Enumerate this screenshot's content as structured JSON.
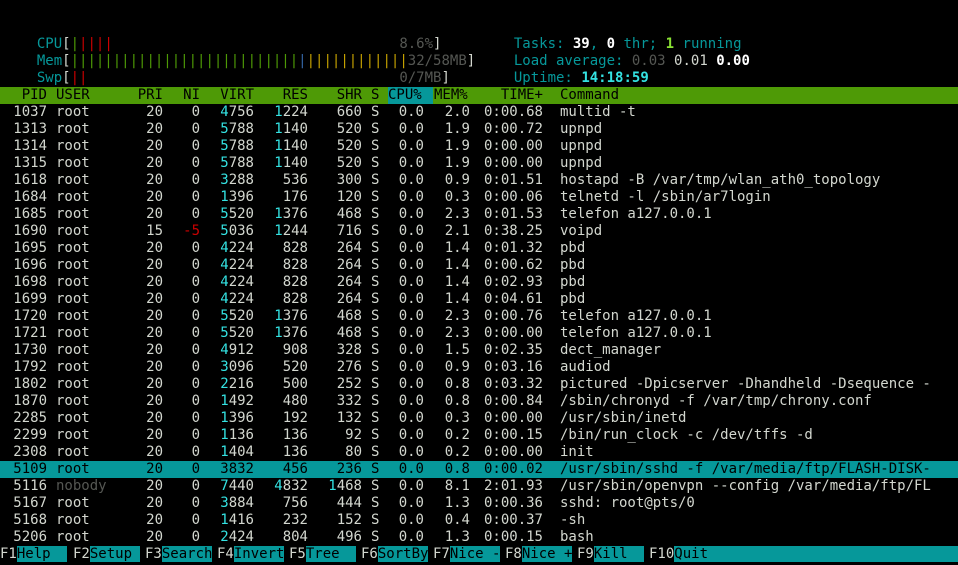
{
  "meters": {
    "cpu": {
      "label": "CPU",
      "value": "8.6%"
    },
    "mem": {
      "label": "Mem",
      "value": "32/58MB"
    },
    "swp": {
      "label": "Swp",
      "value": "0/7MB"
    }
  },
  "summary": {
    "tasks_label": "Tasks:",
    "tasks": "39",
    "sep1": ",",
    "thr": "0",
    "thr_label": "thr;",
    "running": "1",
    "running_label": "running",
    "load_label": "Load average:",
    "load1": "0.03",
    "load5": "0.01",
    "load15": "0.00",
    "uptime_label": "Uptime:",
    "uptime": "14:18:59"
  },
  "columns": [
    "PID",
    "USER",
    "PRI",
    "NI",
    "VIRT",
    "RES",
    "SHR",
    "S",
    "CPU%",
    "MEM%",
    "TIME+",
    "Command"
  ],
  "rows": [
    {
      "pid": "1037",
      "user": "root",
      "pri": "20",
      "ni": "0",
      "virt": "4756",
      "res": "1224",
      "shr": "660",
      "s": "S",
      "cpu": "0.0",
      "mem": "2.0",
      "time": "0:00.68",
      "cmd": "multid -t"
    },
    {
      "pid": "1313",
      "user": "root",
      "pri": "20",
      "ni": "0",
      "virt": "5788",
      "res": "1140",
      "shr": "520",
      "s": "S",
      "cpu": "0.0",
      "mem": "1.9",
      "time": "0:00.72",
      "cmd": "upnpd"
    },
    {
      "pid": "1314",
      "user": "root",
      "pri": "20",
      "ni": "0",
      "virt": "5788",
      "res": "1140",
      "shr": "520",
      "s": "S",
      "cpu": "0.0",
      "mem": "1.9",
      "time": "0:00.00",
      "cmd": "upnpd"
    },
    {
      "pid": "1315",
      "user": "root",
      "pri": "20",
      "ni": "0",
      "virt": "5788",
      "res": "1140",
      "shr": "520",
      "s": "S",
      "cpu": "0.0",
      "mem": "1.9",
      "time": "0:00.00",
      "cmd": "upnpd"
    },
    {
      "pid": "1618",
      "user": "root",
      "pri": "20",
      "ni": "0",
      "virt": "3288",
      "res": "536",
      "shr": "300",
      "s": "S",
      "cpu": "0.0",
      "mem": "0.9",
      "time": "0:01.51",
      "cmd": "hostapd -B /var/tmp/wlan_ath0_topology"
    },
    {
      "pid": "1684",
      "user": "root",
      "pri": "20",
      "ni": "0",
      "virt": "1396",
      "res": "176",
      "shr": "120",
      "s": "S",
      "cpu": "0.0",
      "mem": "0.3",
      "time": "0:00.06",
      "cmd": "telnetd -l /sbin/ar7login"
    },
    {
      "pid": "1685",
      "user": "root",
      "pri": "20",
      "ni": "0",
      "virt": "5520",
      "res": "1376",
      "shr": "468",
      "s": "S",
      "cpu": "0.0",
      "mem": "2.3",
      "time": "0:01.53",
      "cmd": "telefon a127.0.0.1"
    },
    {
      "pid": "1690",
      "user": "root",
      "pri": "15",
      "ni": "-5",
      "virt": "5036",
      "res": "1244",
      "shr": "716",
      "s": "S",
      "cpu": "0.0",
      "mem": "2.1",
      "time": "0:38.25",
      "cmd": "voipd"
    },
    {
      "pid": "1695",
      "user": "root",
      "pri": "20",
      "ni": "0",
      "virt": "4224",
      "res": "828",
      "shr": "264",
      "s": "S",
      "cpu": "0.0",
      "mem": "1.4",
      "time": "0:01.32",
      "cmd": "pbd"
    },
    {
      "pid": "1696",
      "user": "root",
      "pri": "20",
      "ni": "0",
      "virt": "4224",
      "res": "828",
      "shr": "264",
      "s": "S",
      "cpu": "0.0",
      "mem": "1.4",
      "time": "0:00.62",
      "cmd": "pbd"
    },
    {
      "pid": "1698",
      "user": "root",
      "pri": "20",
      "ni": "0",
      "virt": "4224",
      "res": "828",
      "shr": "264",
      "s": "S",
      "cpu": "0.0",
      "mem": "1.4",
      "time": "0:02.93",
      "cmd": "pbd"
    },
    {
      "pid": "1699",
      "user": "root",
      "pri": "20",
      "ni": "0",
      "virt": "4224",
      "res": "828",
      "shr": "264",
      "s": "S",
      "cpu": "0.0",
      "mem": "1.4",
      "time": "0:04.61",
      "cmd": "pbd"
    },
    {
      "pid": "1720",
      "user": "root",
      "pri": "20",
      "ni": "0",
      "virt": "5520",
      "res": "1376",
      "shr": "468",
      "s": "S",
      "cpu": "0.0",
      "mem": "2.3",
      "time": "0:00.76",
      "cmd": "telefon a127.0.0.1"
    },
    {
      "pid": "1721",
      "user": "root",
      "pri": "20",
      "ni": "0",
      "virt": "5520",
      "res": "1376",
      "shr": "468",
      "s": "S",
      "cpu": "0.0",
      "mem": "2.3",
      "time": "0:00.00",
      "cmd": "telefon a127.0.0.1"
    },
    {
      "pid": "1730",
      "user": "root",
      "pri": "20",
      "ni": "0",
      "virt": "4912",
      "res": "908",
      "shr": "328",
      "s": "S",
      "cpu": "0.0",
      "mem": "1.5",
      "time": "0:02.35",
      "cmd": "dect_manager"
    },
    {
      "pid": "1792",
      "user": "root",
      "pri": "20",
      "ni": "0",
      "virt": "3096",
      "res": "520",
      "shr": "276",
      "s": "S",
      "cpu": "0.0",
      "mem": "0.9",
      "time": "0:03.16",
      "cmd": "audiod"
    },
    {
      "pid": "1802",
      "user": "root",
      "pri": "20",
      "ni": "0",
      "virt": "2216",
      "res": "500",
      "shr": "252",
      "s": "S",
      "cpu": "0.0",
      "mem": "0.8",
      "time": "0:03.32",
      "cmd": "pictured -Dpicserver -Dhandheld -Dsequence -"
    },
    {
      "pid": "1870",
      "user": "root",
      "pri": "20",
      "ni": "0",
      "virt": "1492",
      "res": "480",
      "shr": "332",
      "s": "S",
      "cpu": "0.0",
      "mem": "0.8",
      "time": "0:00.84",
      "cmd": "/sbin/chronyd -f /var/tmp/chrony.conf"
    },
    {
      "pid": "2285",
      "user": "root",
      "pri": "20",
      "ni": "0",
      "virt": "1396",
      "res": "192",
      "shr": "132",
      "s": "S",
      "cpu": "0.0",
      "mem": "0.3",
      "time": "0:00.00",
      "cmd": "/usr/sbin/inetd"
    },
    {
      "pid": "2299",
      "user": "root",
      "pri": "20",
      "ni": "0",
      "virt": "1136",
      "res": "136",
      "shr": "92",
      "s": "S",
      "cpu": "0.0",
      "mem": "0.2",
      "time": "0:00.15",
      "cmd": "/bin/run_clock -c /dev/tffs -d"
    },
    {
      "pid": "2308",
      "user": "root",
      "pri": "20",
      "ni": "0",
      "virt": "1404",
      "res": "136",
      "shr": "80",
      "s": "S",
      "cpu": "0.0",
      "mem": "0.2",
      "time": "0:00.00",
      "cmd": "init"
    },
    {
      "pid": "5109",
      "user": "root",
      "pri": "20",
      "ni": "0",
      "virt": "3832",
      "res": "456",
      "shr": "236",
      "s": "S",
      "cpu": "0.0",
      "mem": "0.8",
      "time": "0:00.02",
      "cmd": "/usr/sbin/sshd -f /var/media/ftp/FLASH-DISK-",
      "selected": true
    },
    {
      "pid": "5116",
      "user": "nobody",
      "pri": "20",
      "ni": "0",
      "virt": "7440",
      "res": "4832",
      "shr": "1468",
      "s": "S",
      "cpu": "0.0",
      "mem": "8.1",
      "time": "2:01.93",
      "cmd": "/usr/sbin/openvpn --config /var/media/ftp/FL"
    },
    {
      "pid": "5167",
      "user": "root",
      "pri": "20",
      "ni": "0",
      "virt": "3884",
      "res": "756",
      "shr": "444",
      "s": "S",
      "cpu": "0.0",
      "mem": "1.3",
      "time": "0:00.36",
      "cmd": "sshd: root@pts/0"
    },
    {
      "pid": "5168",
      "user": "root",
      "pri": "20",
      "ni": "0",
      "virt": "1416",
      "res": "232",
      "shr": "152",
      "s": "S",
      "cpu": "0.0",
      "mem": "0.4",
      "time": "0:00.37",
      "cmd": "-sh"
    },
    {
      "pid": "5206",
      "user": "root",
      "pri": "20",
      "ni": "0",
      "virt": "2424",
      "res": "804",
      "shr": "496",
      "s": "S",
      "cpu": "0.0",
      "mem": "1.3",
      "time": "0:00.15",
      "cmd": "bash"
    }
  ],
  "fkeys": [
    {
      "key": "F1",
      "label": "Help  "
    },
    {
      "key": "F2",
      "label": "Setup "
    },
    {
      "key": "F3",
      "label": "Search"
    },
    {
      "key": "F4",
      "label": "Invert"
    },
    {
      "key": "F5",
      "label": "Tree  "
    },
    {
      "key": "F6",
      "label": "SortBy"
    },
    {
      "key": "F7",
      "label": "Nice -"
    },
    {
      "key": "F8",
      "label": "Nice +"
    },
    {
      "key": "F9",
      "label": "Kill  "
    },
    {
      "key": "F10",
      "label": "Quit                                 "
    }
  ],
  "colors": {
    "header_bg": "#4e9a06",
    "selected_bg": "#06989a",
    "accent": "#06989a"
  }
}
